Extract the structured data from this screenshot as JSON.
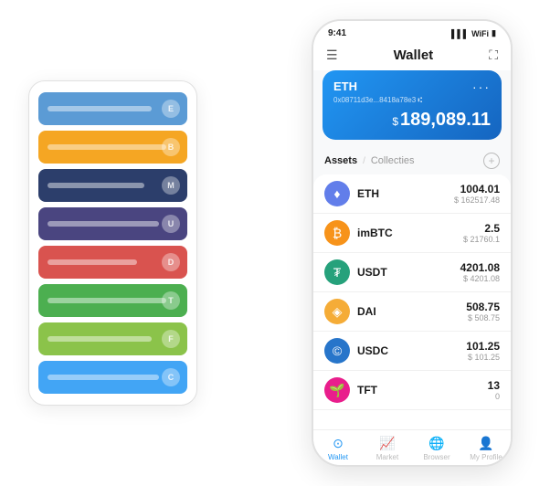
{
  "scene": {
    "background": "#ffffff"
  },
  "cardStack": {
    "cards": [
      {
        "color": "#5B9BD5",
        "lineWidth": "70%",
        "iconLabel": "E"
      },
      {
        "color": "#F5A623",
        "lineWidth": "80%",
        "iconLabel": "B"
      },
      {
        "color": "#2C3E6B",
        "lineWidth": "65%",
        "iconLabel": "M"
      },
      {
        "color": "#4A4580",
        "lineWidth": "75%",
        "iconLabel": "U"
      },
      {
        "color": "#D9534F",
        "lineWidth": "60%",
        "iconLabel": "D"
      },
      {
        "color": "#4CAF50",
        "lineWidth": "80%",
        "iconLabel": "T"
      },
      {
        "color": "#8BC34A",
        "lineWidth": "70%",
        "iconLabel": "F"
      },
      {
        "color": "#42A5F5",
        "lineWidth": "75%",
        "iconLabel": "C"
      }
    ]
  },
  "phone": {
    "statusBar": {
      "time": "9:41",
      "signal": "▌▌▌",
      "wifi": "▲",
      "battery": "▮"
    },
    "header": {
      "menuIcon": "☰",
      "title": "Wallet",
      "expandIcon": "⛶"
    },
    "ethCard": {
      "label": "ETH",
      "dotsMenu": "···",
      "address": "0x08711d3e...8418a78e3  ⑆",
      "balanceSymbol": "$",
      "balance": "189,089.11"
    },
    "assetsSection": {
      "activeTab": "Assets",
      "divider": "/",
      "inactiveTab": "Collecties",
      "addButtonLabel": "+"
    },
    "assets": [
      {
        "name": "ETH",
        "iconBg": "#627EEA",
        "iconText": "♦",
        "amount": "1004.01",
        "usd": "$ 162517.48"
      },
      {
        "name": "imBTC",
        "iconBg": "#F7931A",
        "iconText": "₿",
        "amount": "2.5",
        "usd": "$ 21760.1"
      },
      {
        "name": "USDT",
        "iconBg": "#26A17B",
        "iconText": "₮",
        "amount": "4201.08",
        "usd": "$ 4201.08"
      },
      {
        "name": "DAI",
        "iconBg": "#F5AC37",
        "iconText": "◈",
        "amount": "508.75",
        "usd": "$ 508.75"
      },
      {
        "name": "USDC",
        "iconBg": "#2775CA",
        "iconText": "©",
        "amount": "101.25",
        "usd": "$ 101.25"
      },
      {
        "name": "TFT",
        "iconBg": "#E91E8C",
        "iconText": "🌱",
        "amount": "13",
        "usd": "0"
      }
    ],
    "bottomNav": [
      {
        "id": "wallet",
        "icon": "⊙",
        "label": "Wallet",
        "active": true
      },
      {
        "id": "market",
        "icon": "📈",
        "label": "Market",
        "active": false
      },
      {
        "id": "browser",
        "icon": "🌐",
        "label": "Browser",
        "active": false
      },
      {
        "id": "profile",
        "icon": "👤",
        "label": "My Profile",
        "active": false
      }
    ]
  }
}
